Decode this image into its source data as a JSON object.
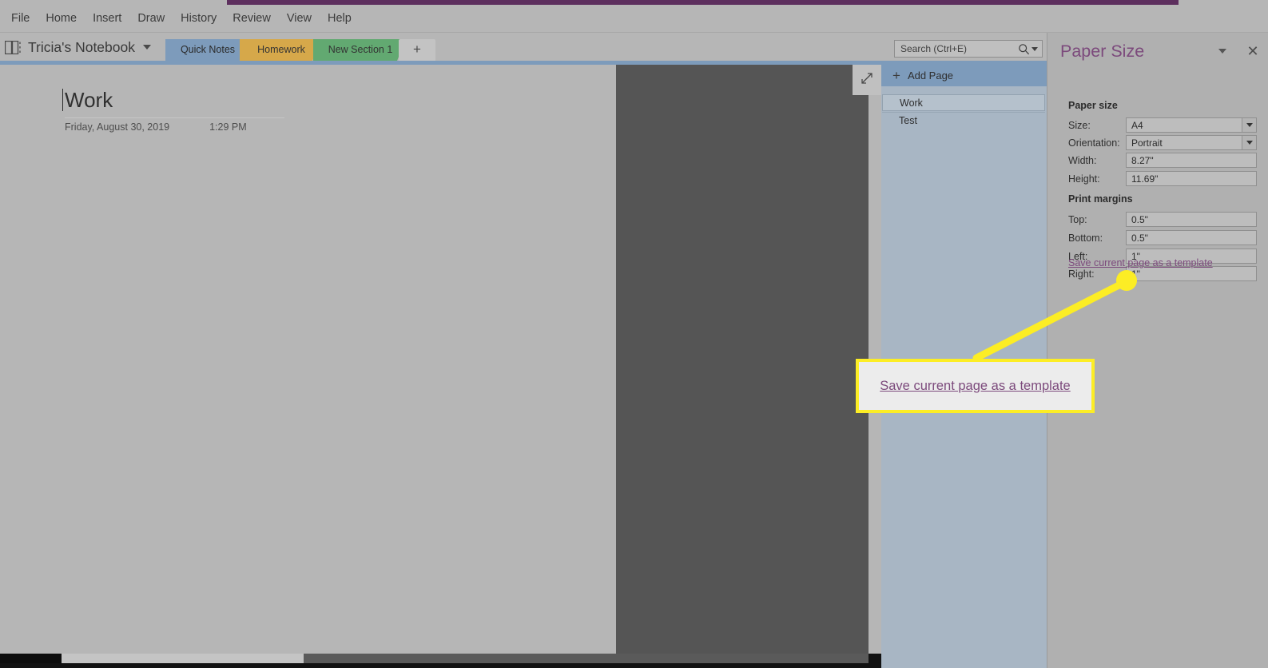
{
  "menu": {
    "items": [
      {
        "label": "File"
      },
      {
        "label": "Home"
      },
      {
        "label": "Insert"
      },
      {
        "label": "Draw"
      },
      {
        "label": "History"
      },
      {
        "label": "Review"
      },
      {
        "label": "View"
      },
      {
        "label": "Help"
      }
    ]
  },
  "notebook": {
    "title": "Tricia's Notebook",
    "icon": "notebook-icon",
    "caret_icon": "chevron-down-icon"
  },
  "section_tabs": [
    {
      "label": "Quick Notes",
      "color": "#7d9bbb",
      "active": true
    },
    {
      "label": "Homework",
      "color": "#d6a84a",
      "active": false
    },
    {
      "label": "New Section 1",
      "color": "#62a971",
      "active": false
    }
  ],
  "add_section": {
    "label": "+"
  },
  "search": {
    "placeholder": "Search (Ctrl+E)",
    "value": "",
    "icon": "search-icon",
    "caret_icon": "chevron-down-icon"
  },
  "page": {
    "title": "Work",
    "date": "Friday, August 30, 2019",
    "time": "1:29 PM"
  },
  "expand_button": {
    "icon": "expand-diagonal-icon"
  },
  "page_list": {
    "add_page_label": "Add Page",
    "add_page_icon": "plus-icon",
    "items": [
      {
        "label": "Work",
        "selected": true
      },
      {
        "label": "Test",
        "selected": false
      }
    ]
  },
  "task_pane": {
    "title": "Paper Size",
    "caret_icon": "chevron-down-icon",
    "close_icon": "close-icon",
    "accent_color": "#7c4a7c",
    "sections": [
      {
        "heading": "Paper size",
        "rows": [
          {
            "label": "Size:",
            "value": "A4",
            "dropdown": true
          },
          {
            "label": "Orientation:",
            "value": "Portrait",
            "dropdown": true
          },
          {
            "label": "Width:",
            "value": "8.27\"",
            "dropdown": false
          },
          {
            "label": "Height:",
            "value": "11.69\"",
            "dropdown": false
          }
        ]
      },
      {
        "heading": "Print margins",
        "rows": [
          {
            "label": "Top:",
            "value": "0.5\"",
            "dropdown": false
          },
          {
            "label": "Bottom:",
            "value": "0.5\"",
            "dropdown": false
          },
          {
            "label": "Left:",
            "value": "1\"",
            "dropdown": false
          },
          {
            "label": "Right:",
            "value": "1\"",
            "dropdown": false
          }
        ]
      }
    ],
    "template_link": "Save current page as a template"
  },
  "annotation": {
    "callout_text": "Save current page as a template",
    "highlight_color": "#fced25"
  }
}
